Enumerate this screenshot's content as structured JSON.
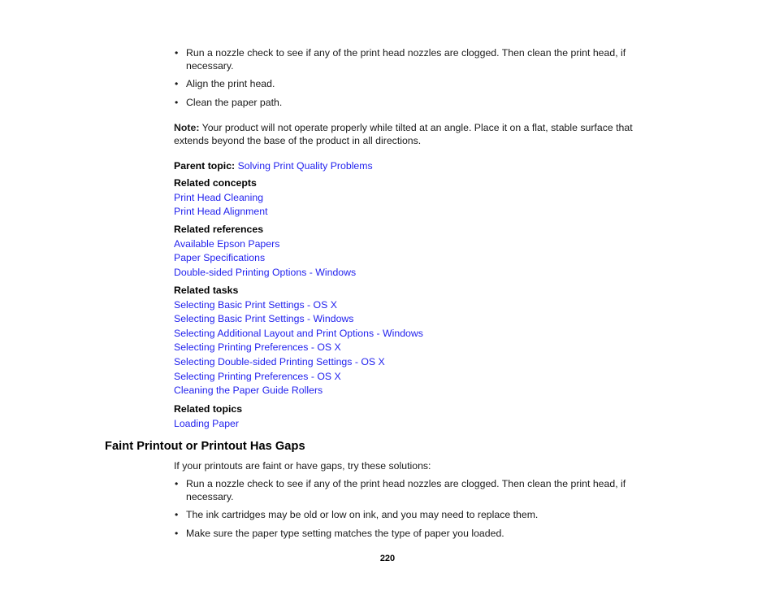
{
  "page": {
    "number": "220"
  },
  "top_solutions": {
    "bullet_glyph": "•",
    "items": [
      "Run a nozzle check to see if any of the print head nozzles are clogged. Then clean the print head, if necessary.",
      "Align the print head.",
      "Clean the paper path."
    ]
  },
  "note": {
    "label": "Note:",
    "text": " Your product will not operate properly while tilted at an angle. Place it on a flat, stable surface that extends beyond the base of the product in all directions."
  },
  "parent_topic": {
    "label": "Parent topic:",
    "link": "Solving Print Quality Problems"
  },
  "related": {
    "concepts": {
      "heading": "Related concepts",
      "links": [
        "Print Head Cleaning",
        "Print Head Alignment"
      ]
    },
    "references": {
      "heading": "Related references",
      "links": [
        "Available Epson Papers",
        "Paper Specifications",
        "Double-sided Printing Options - Windows"
      ]
    },
    "tasks": {
      "heading": "Related tasks",
      "links": [
        "Selecting Basic Print Settings - OS X",
        "Selecting Basic Print Settings - Windows",
        "Selecting Additional Layout and Print Options - Windows",
        "Selecting Printing Preferences - OS X",
        "Selecting Double-sided Printing Settings - OS X",
        "Selecting Printing Preferences - OS X",
        "Cleaning the Paper Guide Rollers"
      ]
    },
    "topics": {
      "heading": "Related topics",
      "links": [
        "Loading Paper"
      ]
    }
  },
  "faint_section": {
    "heading": "Faint Printout or Printout Has Gaps",
    "intro": "If your printouts are faint or have gaps, try these solutions:",
    "bullet_glyph": "•",
    "items": [
      "Run a nozzle check to see if any of the print head nozzles are clogged. Then clean the print head, if necessary.",
      "The ink cartridges may be old or low on ink, and you may need to replace them.",
      "Make sure the paper type setting matches the type of paper you loaded."
    ]
  },
  "colors": {
    "link": "#2222ee",
    "text": "#1a1a1a",
    "background": "#ffffff"
  }
}
